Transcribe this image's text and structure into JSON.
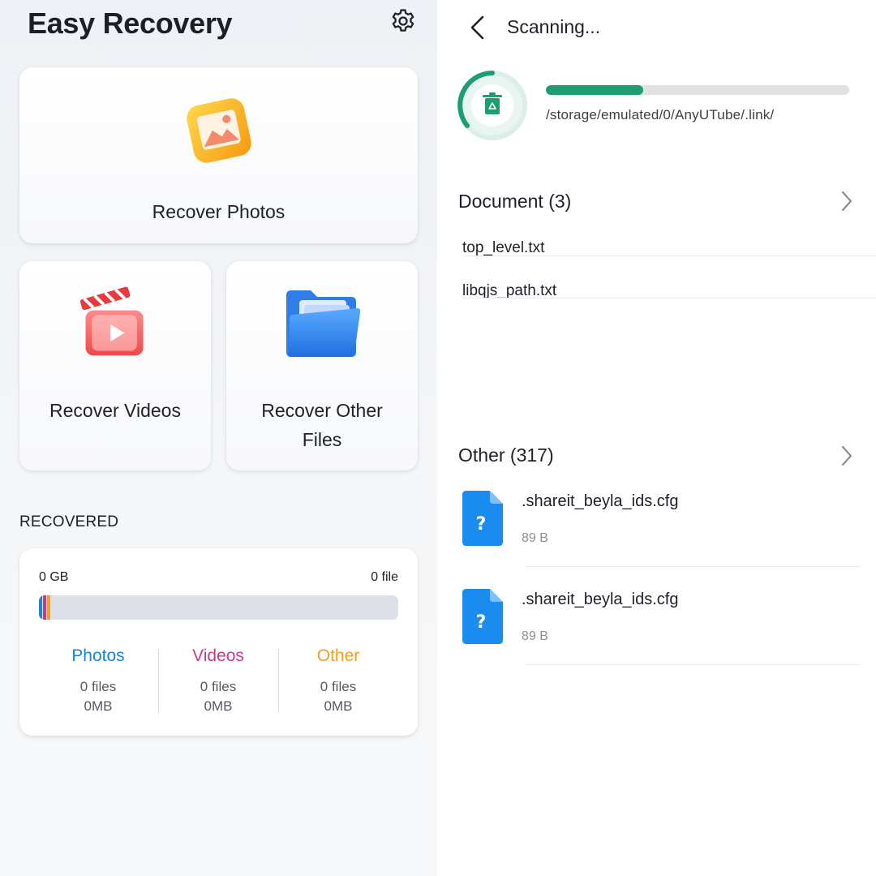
{
  "left": {
    "app_title": "Easy Recovery",
    "cards": {
      "photos": "Recover Photos",
      "videos": "Recover Videos",
      "other": "Recover Other Files"
    },
    "recovered": {
      "title": "RECOVERED",
      "total_size": "0 GB",
      "total_files": "0 file",
      "columns": [
        {
          "title": "Photos",
          "files": "0 files",
          "size": "0MB",
          "color": "#1a84d8"
        },
        {
          "title": "Videos",
          "files": "0 files",
          "size": "0MB",
          "color": "#c23c8e"
        },
        {
          "title": "Other",
          "files": "0 files",
          "size": "0MB",
          "color": "#f2a01d"
        }
      ]
    }
  },
  "right": {
    "title": "Scanning...",
    "progress_percent": 32,
    "scan_path": "/storage/emulated/0/AnyUTube/.link/",
    "document_section": {
      "title": "Document (3)",
      "items": [
        "top_level.txt",
        "libqjs_path.txt"
      ]
    },
    "other_section": {
      "title": "Other (317)",
      "files": [
        {
          "name": ".shareit_beyla_ids.cfg",
          "size": "89 B"
        },
        {
          "name": ".shareit_beyla_ids.cfg",
          "size": "89 B"
        }
      ]
    }
  },
  "colors": {
    "progress": "#1c9e6e",
    "file_icon": "#1a8cf0",
    "photos": "#1a84d8",
    "videos": "#c23c8e",
    "other": "#f2a01d"
  }
}
